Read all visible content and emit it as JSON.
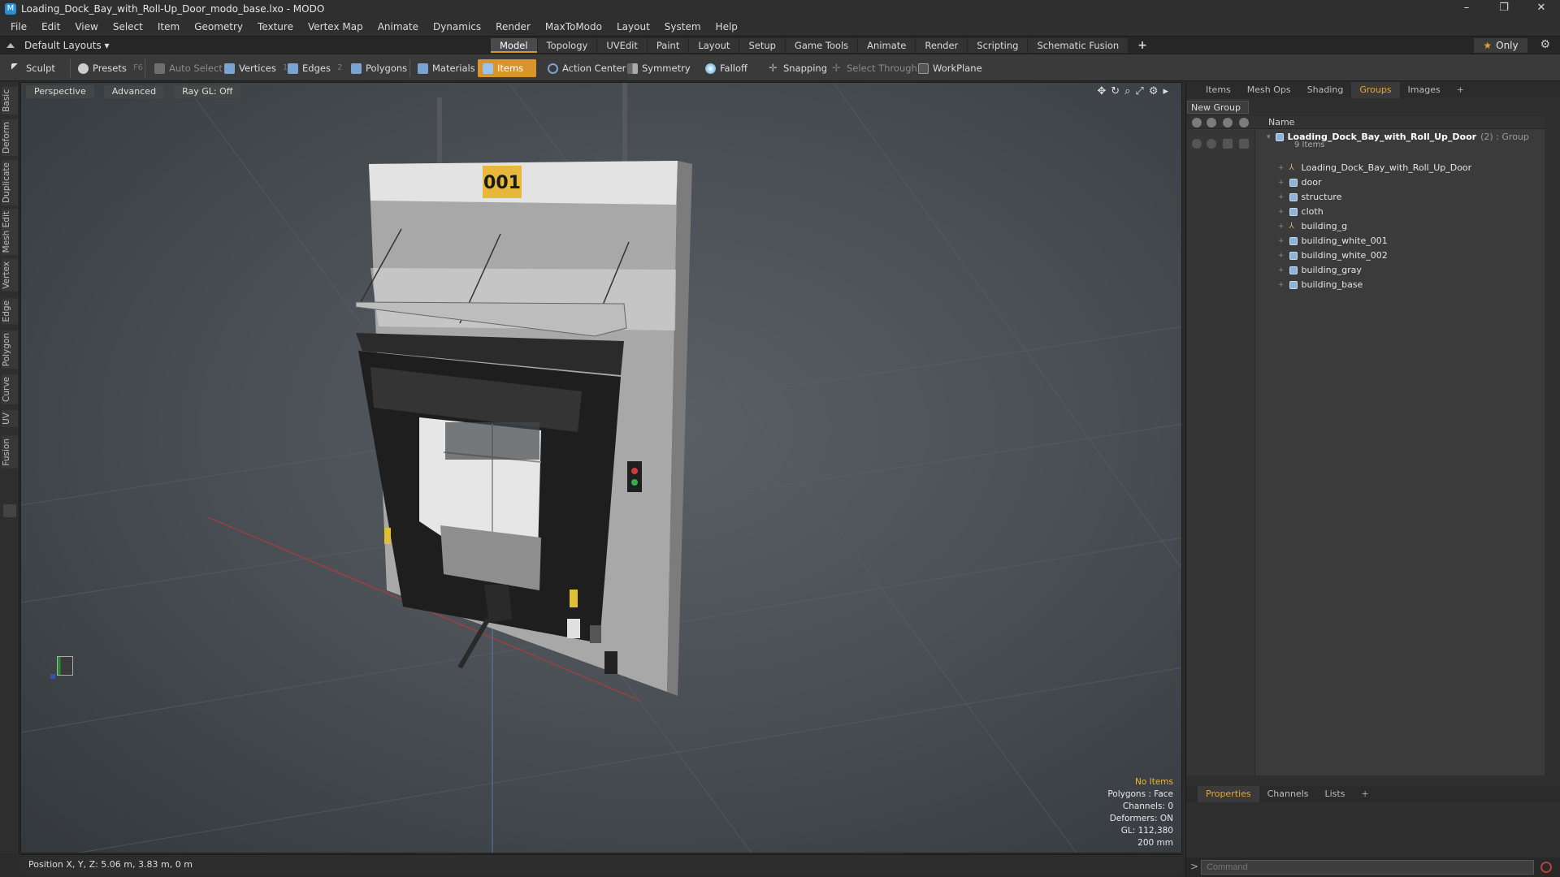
{
  "window": {
    "title": "Loading_Dock_Bay_with_Roll-Up_Door_modo_base.lxo - MODO",
    "controls": [
      "–",
      "❐",
      "✕"
    ]
  },
  "menu": [
    "File",
    "Edit",
    "View",
    "Select",
    "Item",
    "Geometry",
    "Texture",
    "Vertex Map",
    "Animate",
    "Dynamics",
    "Render",
    "MaxToModo",
    "Layout",
    "System",
    "Help"
  ],
  "layout_row": {
    "layouts_label": "Default Layouts ▾",
    "tabs": [
      "Model",
      "Topology",
      "UVEdit",
      "Paint",
      "Layout",
      "Setup",
      "Game Tools",
      "Animate",
      "Render",
      "Scripting",
      "Schematic Fusion"
    ],
    "active_tab": "Model",
    "only_label": "Only"
  },
  "toolbar": {
    "sculpt": "Sculpt",
    "presets": "Presets",
    "presets_key": "F6",
    "auto_select": "Auto Select",
    "vertices": "Vertices",
    "vertices_key": "1",
    "edges": "Edges",
    "edges_key": "2",
    "polygons": "Polygons",
    "materials": "Materials",
    "items": "Items",
    "action_center": "Action Center",
    "symmetry": "Symmetry",
    "falloff": "Falloff",
    "snapping": "Snapping",
    "select_through": "Select Through",
    "workplane": "WorkPlane"
  },
  "left_tabs": [
    "Basic",
    "Deform",
    "Duplicate",
    "Mesh Edit",
    "Vertex",
    "Edge",
    "Polygon",
    "Curve",
    "UV",
    "Fusion"
  ],
  "viewport": {
    "view_mode": "Perspective",
    "shading": "Advanced",
    "raygl": "Ray GL: Off",
    "door_number": "001",
    "stats": {
      "selection": "No Items",
      "polygons": "Polygons : Face",
      "channels": "Channels: 0",
      "deformers": "Deformers: ON",
      "gl": "GL: 112,380",
      "scale": "200 mm"
    }
  },
  "status": {
    "position": "Position X, Y, Z:   5.06 m, 3.83 m, 0 m"
  },
  "right_panel": {
    "tabs": [
      "Items",
      "Mesh Ops",
      "Shading",
      "Groups",
      "Images"
    ],
    "active_tab": "Groups",
    "new_group": "New Group",
    "name_header": "Name",
    "group": {
      "name": "Loading_Dock_Bay_with_Roll_Up_Door",
      "info": "(2) : Group",
      "count": "9 Items"
    },
    "items": [
      {
        "name": "Loading_Dock_Bay_with_Roll_Up_Door",
        "kind": "locator"
      },
      {
        "name": "door",
        "kind": "mesh"
      },
      {
        "name": "structure",
        "kind": "mesh"
      },
      {
        "name": "cloth",
        "kind": "mesh"
      },
      {
        "name": "building_g",
        "kind": "locator"
      },
      {
        "name": "building_white_001",
        "kind": "mesh"
      },
      {
        "name": "building_white_002",
        "kind": "mesh"
      },
      {
        "name": "building_gray",
        "kind": "mesh"
      },
      {
        "name": "building_base",
        "kind": "mesh"
      }
    ],
    "bottom_tabs": [
      "Properties",
      "Channels",
      "Lists"
    ],
    "bottom_active": "Properties",
    "command_placeholder": "Command"
  }
}
